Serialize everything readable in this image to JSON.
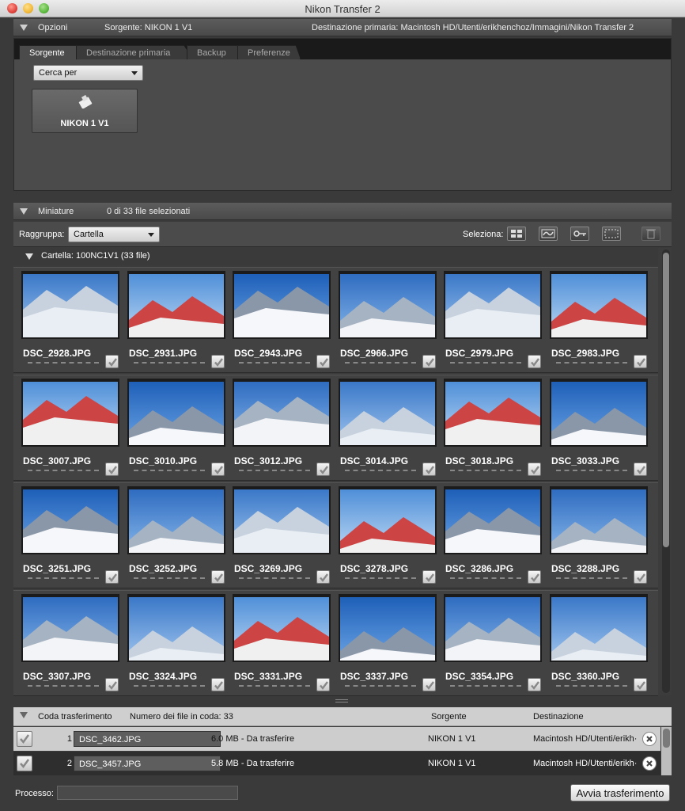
{
  "window": {
    "title": "Nikon Transfer 2"
  },
  "options": {
    "label": "Opzioni",
    "source": "Sorgente: NIKON 1 V1",
    "destination": "Destinazione primaria: Macintosh HD/Utenti/erikhenchoz/Immagini/Nikon Transfer 2",
    "tabs": [
      {
        "label": "Sorgente",
        "active": true
      },
      {
        "label": "Destinazione primaria",
        "active": false
      },
      {
        "label": "Backup",
        "active": false
      },
      {
        "label": "Preferenze",
        "active": false
      }
    ],
    "search_select": "Cerca per",
    "device": {
      "label": "NIKON 1 V1",
      "icon": "camera-device-icon"
    }
  },
  "thumbnails": {
    "label": "Miniature",
    "selected_count": "0 di 33 file selezionati",
    "group_label": "Raggruppa:",
    "group_value": "Cartella",
    "select_label": "Seleziona:",
    "select_buttons": [
      "select-all-icon",
      "select-wave-icon",
      "select-key-icon",
      "select-none-icon"
    ],
    "trash_icon": "trash-icon",
    "folder_header": "Cartella: 100NC1V1 (33 file)",
    "items": [
      {
        "name": "DSC_2928.JPG",
        "checked": true
      },
      {
        "name": "DSC_2931.JPG",
        "checked": true
      },
      {
        "name": "DSC_2943.JPG",
        "checked": true
      },
      {
        "name": "DSC_2966.JPG",
        "checked": true
      },
      {
        "name": "DSC_2979.JPG",
        "checked": true
      },
      {
        "name": "DSC_2983.JPG",
        "checked": true
      },
      {
        "name": "DSC_3007.JPG",
        "checked": true
      },
      {
        "name": "DSC_3010.JPG",
        "checked": true
      },
      {
        "name": "DSC_3012.JPG",
        "checked": true
      },
      {
        "name": "DSC_3014.JPG",
        "checked": true
      },
      {
        "name": "DSC_3018.JPG",
        "checked": true
      },
      {
        "name": "DSC_3033.JPG",
        "checked": true
      },
      {
        "name": "DSC_3251.JPG",
        "checked": true
      },
      {
        "name": "DSC_3252.JPG",
        "checked": true
      },
      {
        "name": "DSC_3269.JPG",
        "checked": true
      },
      {
        "name": "DSC_3278.JPG",
        "checked": true
      },
      {
        "name": "DSC_3286.JPG",
        "checked": true
      },
      {
        "name": "DSC_3288.JPG",
        "checked": true
      },
      {
        "name": "DSC_3307.JPG",
        "checked": true
      },
      {
        "name": "DSC_3324.JPG",
        "checked": true
      },
      {
        "name": "DSC_3331.JPG",
        "checked": true
      },
      {
        "name": "DSC_3337.JPG",
        "checked": true
      },
      {
        "name": "DSC_3354.JPG",
        "checked": true
      },
      {
        "name": "DSC_3360.JPG",
        "checked": true
      }
    ]
  },
  "queue": {
    "label": "Coda trasferimento",
    "count": "Numero dei file in coda: 33",
    "col_source": "Sorgente",
    "col_destination": "Destinazione",
    "rows": [
      {
        "index": "1",
        "file": "DSC_3462.JPG",
        "info": "6.0 MB - Da trasferire",
        "source": "NIKON 1 V1",
        "destination": "Macintosh HD/Utenti/erikh···"
      },
      {
        "index": "2",
        "file": "DSC_3457.JPG",
        "info": "5.8 MB - Da trasferire",
        "source": "NIKON 1 V1",
        "destination": "Macintosh HD/Utenti/erikh···"
      }
    ]
  },
  "footer": {
    "process_label": "Processo:",
    "start_button": "Avvia trasferimento"
  },
  "colors": {
    "accent_sky": "#3a78c8",
    "panel": "#4b4b4b",
    "dark": "#3a3a3a"
  }
}
